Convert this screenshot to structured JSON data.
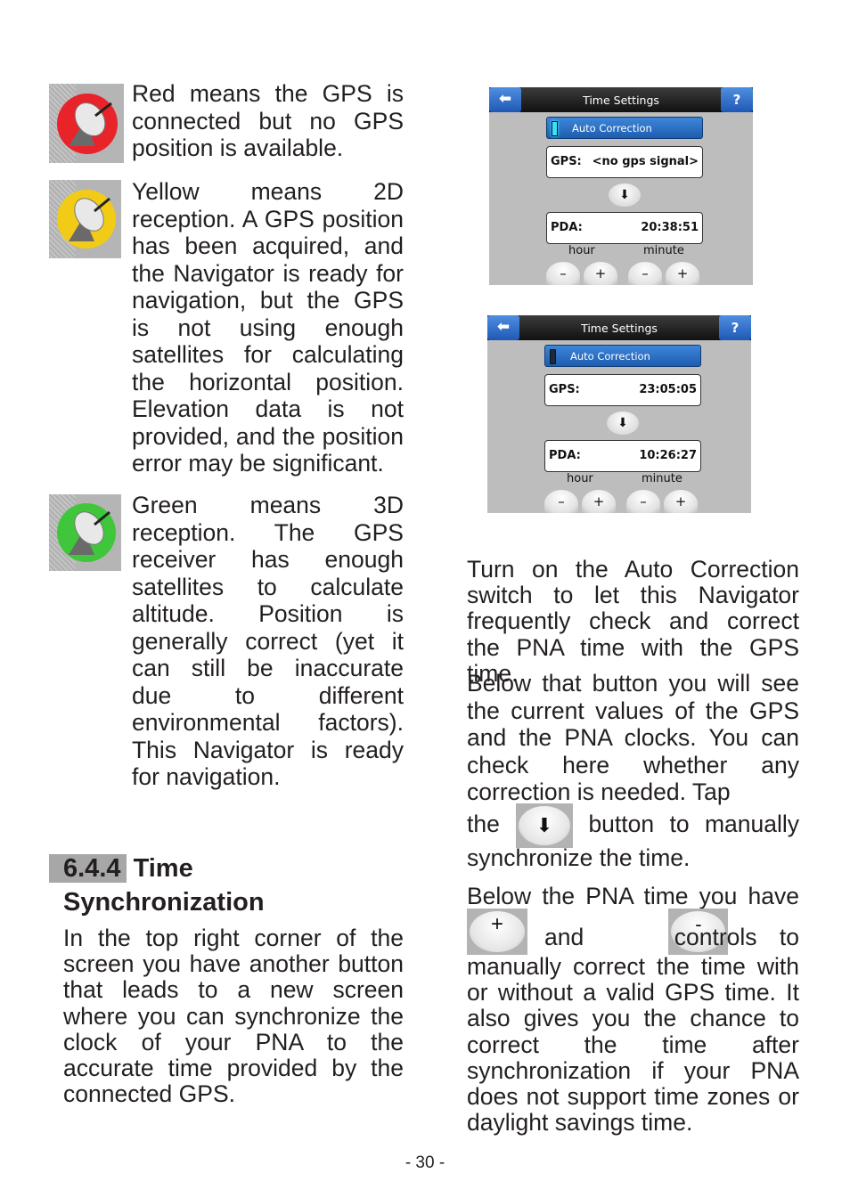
{
  "left_column": {
    "status_items": [
      {
        "icon": "gps-red-icon",
        "color": "#e8232a",
        "text": "Red means the GPS is connected but no GPS position is available."
      },
      {
        "icon": "gps-yellow-icon",
        "color": "#f2cb16",
        "text": "Yellow means 2D reception. A GPS position has been acquired, and the Navigator is ready for navigation, but the GPS is not using enough satellites for calculating the horizontal position. Elevation data is not provided, and the position error may be significant."
      },
      {
        "icon": "gps-green-icon",
        "color": "#3fc63a",
        "text": "Green means 3D reception. The GPS receiver has enough satellites to calculate altitude. Position is generally correct (yet it can still be inaccurate due to different environmental factors). This Navigator is ready for navigation."
      }
    ],
    "section": {
      "number": "6.4.4",
      "title_line1": "Time",
      "title_line2": "Synchronization",
      "body": "In the top right corner of the screen you have another button that leads to a new screen where you can synchronize the clock of your PNA to the accurate time provided by the connected GPS."
    }
  },
  "screenshots": [
    {
      "title": "Time Settings",
      "back_icon": "back-arrow-icon",
      "help_label": "?",
      "auto_correction_label": "Auto Correction",
      "auto_correction_on": true,
      "gps_label": "GPS:",
      "gps_value": "<no gps signal>",
      "sync_icon": "down-arrow-icon",
      "pda_label": "PDA:",
      "pda_value": "20:38:51",
      "hour_label": "hour",
      "minute_label": "minute",
      "minus": "–",
      "plus": "+"
    },
    {
      "title": "Time Settings",
      "back_icon": "back-arrow-icon",
      "help_label": "?",
      "auto_correction_label": "Auto Correction",
      "auto_correction_on": false,
      "gps_label": "GPS:",
      "gps_value": "23:05:05",
      "sync_icon": "down-arrow-icon",
      "pda_label": "PDA:",
      "pda_value": "10:26:27",
      "hour_label": "hour",
      "minute_label": "minute",
      "minus": "–",
      "plus": "+"
    }
  ],
  "right_column": {
    "p1": "Turn on the Auto Correction switch to let this Navigator frequently check and correct the PNA time with the GPS time.",
    "p2": "Below that button you will see the current values of the GPS and the PNA clocks. You can check here whether any correction is needed. Tap",
    "p2_the": "the",
    "p2_after": "button to manually",
    "p2_end": "synchronize the time.",
    "p3_start": "Below the PNA time you have",
    "p3_and": "and",
    "p3_controls": "controls to",
    "p3_rest": "manually correct the time with or without a valid GPS time. It also gives you the chance to correct the time after synchronization if your PNA does not support time zones or daylight savings time.",
    "inline_plus": "+",
    "inline_minus": "-",
    "inline_sync": "⬇"
  },
  "footer": {
    "page_number": "- 30 -"
  }
}
